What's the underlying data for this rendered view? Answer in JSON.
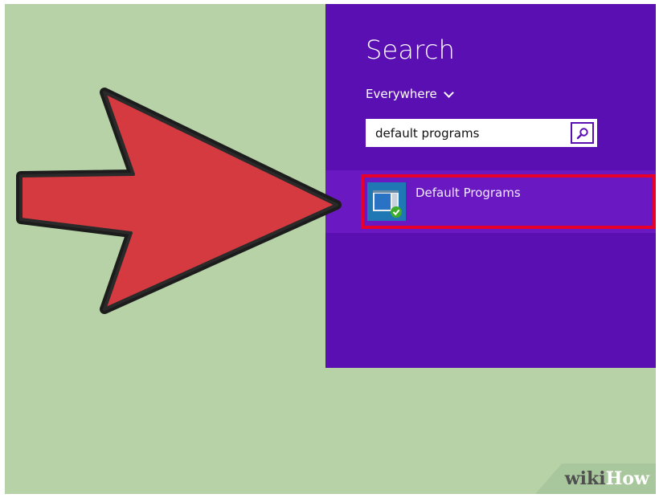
{
  "search_pane": {
    "title": "Search",
    "scope_label": "Everywhere",
    "query_value": "default programs",
    "search_button_icon": "magnifier-icon"
  },
  "results": [
    {
      "label": "Default Programs",
      "icon": "default-programs-icon",
      "highlighted": true
    }
  ],
  "annotations": {
    "arrow_color": "#d63a41",
    "highlight_color": "#e8002a"
  },
  "colors": {
    "background": "#b8d2a8",
    "charm_bg": "#5a0fb3",
    "result_bg": "#6a19c2"
  },
  "watermark": {
    "part1": "wiki",
    "part2": "How"
  }
}
